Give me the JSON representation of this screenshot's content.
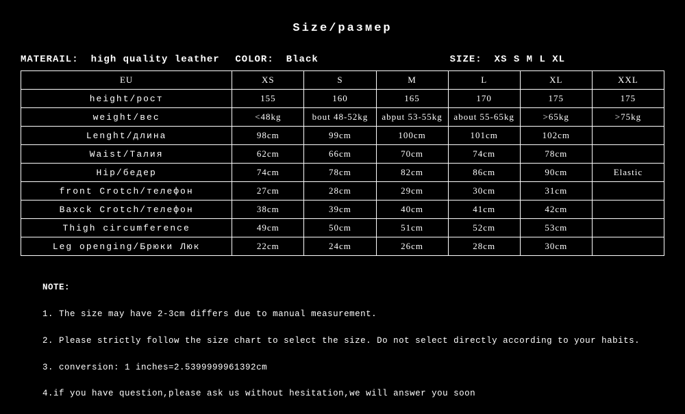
{
  "title": "Size/размер",
  "meta": {
    "material_label": "MATERAIL:",
    "material_value": "high quality leather",
    "color_label": "COLOR:",
    "color_value": "Black",
    "size_label": "SIZE:",
    "size_value": "XS S M L XL"
  },
  "chart_data": {
    "type": "table",
    "columns": [
      "EU",
      "XS",
      "S",
      "M",
      "L",
      "XL",
      "XXL"
    ],
    "rows": [
      {
        "attr": "height/рост",
        "v": [
          "155",
          "160",
          "165",
          "170",
          "175",
          "175"
        ]
      },
      {
        "attr": "weight/вес",
        "v": [
          "<48kg",
          "bout 48-52kg",
          "abput 53-55kg",
          "about 55-65kg",
          ">65kg",
          ">75kg"
        ]
      },
      {
        "attr": "Lenght/длина",
        "v": [
          "98cm",
          "99cm",
          "100cm",
          "101cm",
          "102cm",
          ""
        ]
      },
      {
        "attr": "Waist/Талия",
        "v": [
          "62cm",
          "66cm",
          "70cm",
          "74cm",
          "78cm",
          ""
        ]
      },
      {
        "attr": "Hip/бедер",
        "v": [
          "74cm",
          "78cm",
          "82cm",
          "86cm",
          "90cm",
          "Elastic"
        ]
      },
      {
        "attr": "front Crotch/телефон",
        "v": [
          "27cm",
          "28cm",
          "29cm",
          "30cm",
          "31cm",
          ""
        ]
      },
      {
        "attr": "Baxck Crotch/телефон",
        "v": [
          "38cm",
          "39cm",
          "40cm",
          "41cm",
          "42cm",
          ""
        ]
      },
      {
        "attr": "Thigh circumference",
        "v": [
          "49cm",
          "50cm",
          "51cm",
          "52cm",
          "53cm",
          ""
        ]
      },
      {
        "attr": "Leg openging/Брюки Люк",
        "v": [
          "22cm",
          "24cm",
          "26cm",
          "28cm",
          "30cm",
          ""
        ]
      }
    ]
  },
  "note": {
    "heading": "NOTE:",
    "lines": [
      "1. The size may have 2-3cm differs due to manual measurement.",
      "2. Please strictly follow the size chart to select the size. Do not select directly according to your habits.",
      "3. conversion: 1 inches=2.5399999961392cm",
      "4.if you have question,please ask us without hesitation,we will answer you soon"
    ]
  }
}
